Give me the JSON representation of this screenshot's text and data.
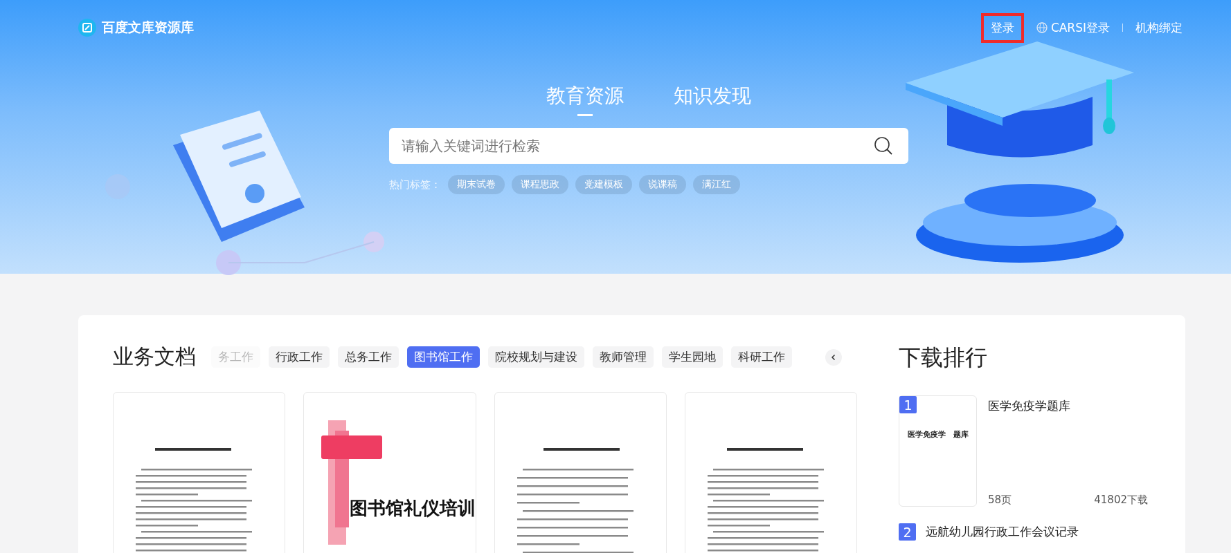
{
  "header": {
    "logo": "百度文库资源库",
    "login": "登录",
    "carsi_login": "CARSI登录",
    "bind": "机构绑定"
  },
  "hero": {
    "tabs": [
      {
        "label": "教育资源",
        "selected": true
      },
      {
        "label": "知识发现",
        "selected": false
      }
    ],
    "search": {
      "placeholder": "请输入关键词进行检索"
    },
    "hot_label": "热门标签：",
    "hot_tags": [
      "期末试卷",
      "课程思政",
      "党建模板",
      "说课稿",
      "满江红"
    ]
  },
  "docs": {
    "title": "业务文档",
    "categories": [
      {
        "label": "务工作",
        "selected": false,
        "faded": true
      },
      {
        "label": "行政工作",
        "selected": false,
        "faded": false
      },
      {
        "label": "总务工作",
        "selected": false,
        "faded": false
      },
      {
        "label": "图书馆工作",
        "selected": true,
        "faded": false
      },
      {
        "label": "院校规划与建设",
        "selected": false,
        "faded": false
      },
      {
        "label": "教师管理",
        "selected": false,
        "faded": false
      },
      {
        "label": "学生园地",
        "selected": false,
        "faded": false
      },
      {
        "label": "科研工作",
        "selected": false,
        "faded": false
      }
    ],
    "cards": [
      {
        "kind": "page"
      },
      {
        "kind": "cover",
        "title": "图书馆礼仪培训"
      },
      {
        "kind": "page"
      },
      {
        "kind": "page"
      }
    ]
  },
  "ranking": {
    "title": "下载排行",
    "items": [
      {
        "rank": "1",
        "title": "医学免疫学题库",
        "thumb_title": "医学免疫学　题库",
        "pages": "58页",
        "downloads": "41802下载"
      },
      {
        "rank": "2",
        "title": "远航幼儿园行政工作会议记录"
      }
    ]
  }
}
